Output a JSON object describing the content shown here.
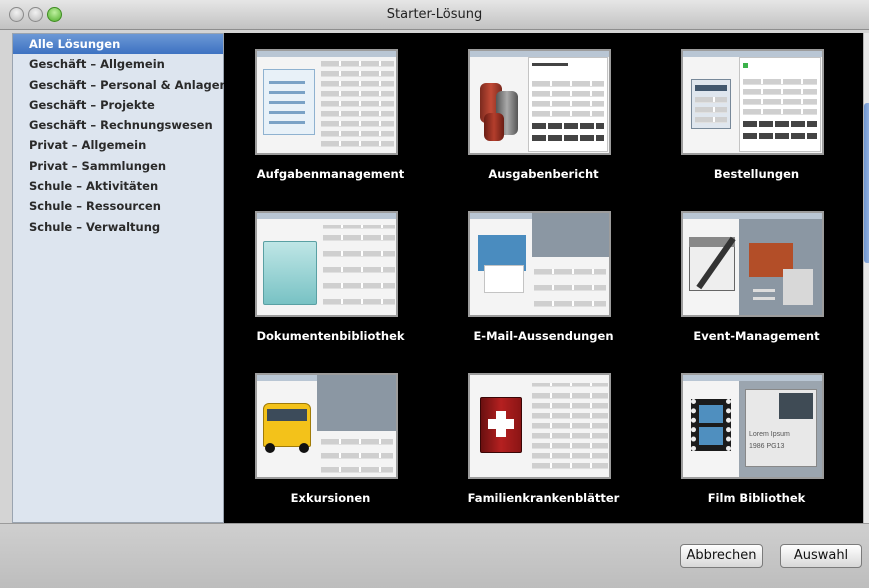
{
  "window": {
    "title": "Starter-Lösung"
  },
  "sidebar": {
    "items": [
      {
        "label": "Alle Lösungen",
        "selected": true
      },
      {
        "label": "Geschäft – Allgemein"
      },
      {
        "label": "Geschäft – Personal & Anlagen"
      },
      {
        "label": "Geschäft – Projekte"
      },
      {
        "label": "Geschäft – Rechnungswesen"
      },
      {
        "label": "Privat – Allgemein"
      },
      {
        "label": "Privat – Sammlungen"
      },
      {
        "label": "Schule – Aktivitäten"
      },
      {
        "label": "Schule – Ressourcen"
      },
      {
        "label": "Schule – Verwaltung"
      }
    ]
  },
  "gallery": {
    "tiles": [
      {
        "label": "Aufgabenmanagement",
        "icon": "checklist-icon"
      },
      {
        "label": "Ausgabenbericht",
        "icon": "coins-icon"
      },
      {
        "label": "Bestellungen",
        "icon": "order-table-icon"
      },
      {
        "label": "Dokumentenbibliothek",
        "icon": "folder-icon"
      },
      {
        "label": "E-Mail-Aussendungen",
        "icon": "envelope-icon"
      },
      {
        "label": "Event-Management",
        "icon": "calendar-pen-icon"
      },
      {
        "label": "Exkursionen",
        "icon": "school-bus-icon"
      },
      {
        "label": "Familienkrankenblätter",
        "icon": "medical-book-icon"
      },
      {
        "label": "Film Bibliothek",
        "icon": "film-strip-icon"
      }
    ],
    "sample_text": {
      "lorem_heading": "Lorem Ipsum",
      "film_year": "1986 PG13"
    }
  },
  "footer": {
    "cancel_label": "Abbrechen",
    "choose_label": "Auswahl"
  }
}
